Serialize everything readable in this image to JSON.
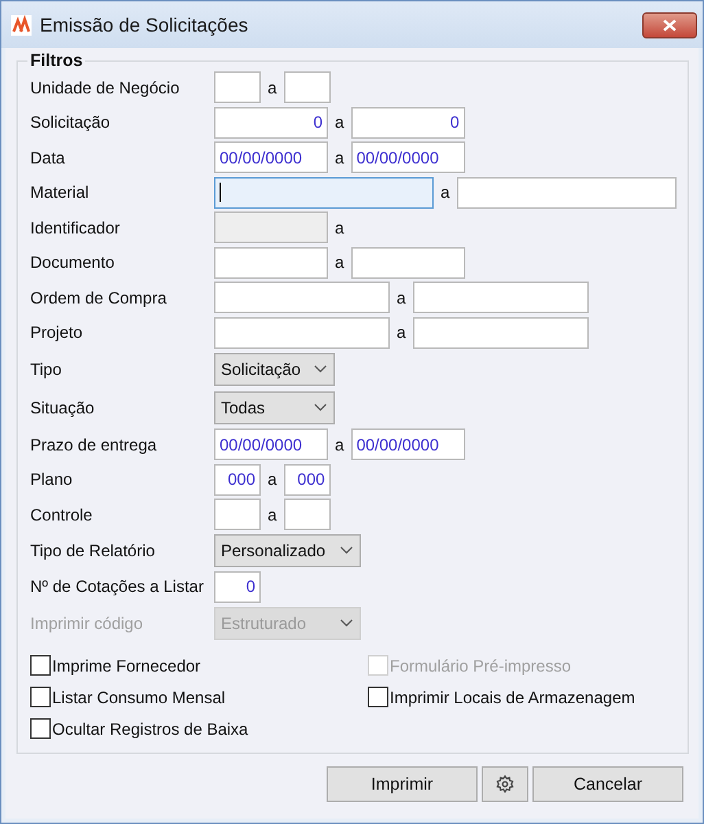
{
  "window": {
    "title": "Emissão de Solicitações"
  },
  "filters": {
    "title": "Filtros",
    "rows": [
      {
        "label": "Unidade de Negócio",
        "kind": "tiny",
        "separator": "a",
        "from": {
          "kind": "text"
        },
        "to": {
          "kind": "text"
        }
      },
      {
        "label": "Solicitação",
        "kind": "pair",
        "separator": "a",
        "from": {
          "kind": "number",
          "value": "0"
        },
        "to": {
          "kind": "number",
          "value": "0"
        }
      },
      {
        "label": "Data",
        "kind": "pair",
        "separator": "a",
        "from": {
          "kind": "date",
          "value": "00/00/0000"
        },
        "to": {
          "kind": "date",
          "value": "00/00/0000"
        }
      },
      {
        "label": "Material",
        "kind": "long",
        "separator": "a",
        "from": {
          "kind": "text",
          "focused": true
        },
        "to": {
          "kind": "text"
        }
      },
      {
        "label": "Identificador",
        "kind": "pair",
        "separator": "a",
        "from": {
          "kind": "text",
          "disabled": true
        }
      },
      {
        "label": "Documento",
        "kind": "pair",
        "separator": "a",
        "from": {
          "kind": "text"
        },
        "to": {
          "kind": "text"
        }
      },
      {
        "label": "Ordem de Compra",
        "kind": "wide",
        "separator": "a",
        "from": {
          "kind": "text"
        },
        "to": {
          "kind": "text"
        }
      },
      {
        "label": "Projeto",
        "kind": "wide",
        "separator": "a",
        "from": {
          "kind": "text"
        },
        "to": {
          "kind": "text"
        }
      },
      {
        "label": "Tipo",
        "kind": "select",
        "value": "Solicitação"
      },
      {
        "label": "Situação",
        "kind": "select",
        "value": "Todas"
      },
      {
        "label": "Prazo de entrega",
        "kind": "pair",
        "separator": "a",
        "from": {
          "kind": "date",
          "value": "00/00/0000"
        },
        "to": {
          "kind": "date",
          "value": "00/00/0000"
        }
      },
      {
        "label": "Plano",
        "kind": "tiny",
        "separator": "a",
        "from": {
          "kind": "number",
          "value": "000"
        },
        "to": {
          "kind": "number",
          "value": "000"
        }
      },
      {
        "label": "Controle",
        "kind": "tiny",
        "separator": "a",
        "from": {
          "kind": "text"
        },
        "to": {
          "kind": "text"
        }
      },
      {
        "label": "Tipo de Relatório",
        "kind": "picker",
        "value": "Personalizado"
      },
      {
        "label": "Nº de Cotações a Listar",
        "kind": "single",
        "from": {
          "kind": "number",
          "value": "0"
        }
      },
      {
        "label": "Imprimir código",
        "kind": "picker",
        "value": "Estruturado",
        "disabled": true
      }
    ],
    "checkboxes": [
      {
        "label": "Imprime Fornecedor",
        "checked": false,
        "disabled": false
      },
      {
        "label": "Formulário Pré-impresso",
        "checked": false,
        "disabled": true
      },
      {
        "label": "Listar Consumo Mensal",
        "checked": false,
        "disabled": false
      },
      {
        "label": "Imprimir Locais de Armazenagem",
        "checked": false,
        "disabled": false
      },
      {
        "label": "Ocultar Registros de Baixa",
        "checked": false,
        "disabled": false
      }
    ]
  },
  "buttons": [
    {
      "kind": "text",
      "label": "Imprimir"
    },
    {
      "kind": "settings"
    },
    {
      "kind": "text",
      "label": "Cancelar"
    }
  ]
}
